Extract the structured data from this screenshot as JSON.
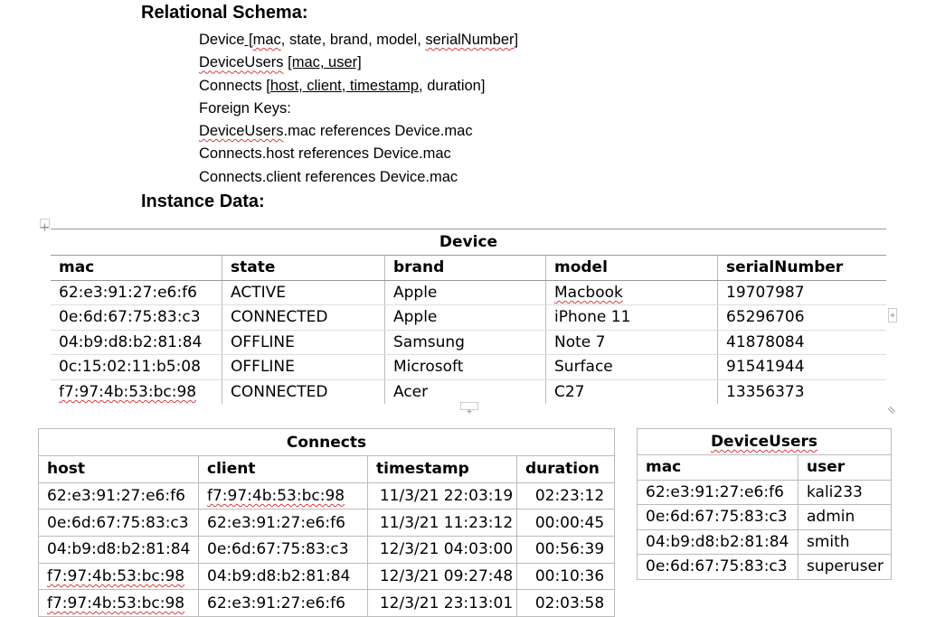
{
  "headings": {
    "schema": "Relational Schema:",
    "instance": "Instance Data:"
  },
  "schema": {
    "device": {
      "name": "Device",
      "open": " [",
      "k1": "mac",
      "rest": ", state, brand, model, ",
      "k2": "serialNumber",
      "close": "]"
    },
    "device_users": {
      "name": "DeviceUsers",
      "open": " ",
      "keys": "[mac, user]"
    },
    "connects": {
      "name": "Connects",
      "open": " [",
      "keys": "host, client, timestamp",
      "rest": ", duration]"
    },
    "fk_title": "Foreign Keys:",
    "fk1": {
      "a": "DeviceUsers",
      "b": ".mac references Device.mac"
    },
    "fk2": "Connects.host references Device.mac",
    "fk3": "Connects.client references Device.mac"
  },
  "device_table": {
    "title": "Device",
    "columns": [
      "mac",
      "state",
      "brand",
      "model",
      "serialNumber"
    ],
    "rows": [
      [
        "62:e3:91:27:e6:f6",
        "ACTIVE",
        "Apple",
        "Macbook",
        "19707987"
      ],
      [
        "0e:6d:67:75:83:c3",
        "CONNECTED",
        "Apple",
        "iPhone 11",
        "65296706"
      ],
      [
        "04:b9:d8:b2:81:84",
        "OFFLINE",
        "Samsung",
        "Note 7",
        "41878084"
      ],
      [
        "0c:15:02:11:b5:08",
        "OFFLINE",
        "Microsoft",
        "Surface",
        "91541944"
      ],
      [
        "f7:97:4b:53:bc:98",
        "CONNECTED",
        "Acer",
        "C27",
        "13356373"
      ]
    ]
  },
  "connects_table": {
    "title": "Connects",
    "columns": [
      "host",
      "client",
      "timestamp",
      "duration"
    ],
    "rows": [
      [
        "62:e3:91:27:e6:f6",
        "f7:97:4b:53:bc:98",
        "11/3/21 22:03:19",
        "02:23:12"
      ],
      [
        "0e:6d:67:75:83:c3",
        "62:e3:91:27:e6:f6",
        "11/3/21 11:23:12",
        "00:00:45"
      ],
      [
        "04:b9:d8:b2:81:84",
        "0e:6d:67:75:83:c3",
        "12/3/21 04:03:00",
        "00:56:39"
      ],
      [
        "f7:97:4b:53:bc:98",
        "04:b9:d8:b2:81:84",
        "12/3/21 09:27:48",
        "00:10:36"
      ],
      [
        "f7:97:4b:53:bc:98",
        "62:e3:91:27:e6:f6",
        "12/3/21 23:13:01",
        "02:03:58"
      ]
    ]
  },
  "device_users_table": {
    "title": "DeviceUsers",
    "columns": [
      "mac",
      "user"
    ],
    "rows": [
      [
        "62:e3:91:27:e6:f6",
        "kali233"
      ],
      [
        "0e:6d:67:75:83:c3",
        "admin"
      ],
      [
        "04:b9:d8:b2:81:84",
        "smith"
      ],
      [
        "0e:6d:67:75:83:c3",
        "superuser"
      ]
    ]
  },
  "icons": {
    "table_move": "move-handle-icon",
    "add_row": "add-row-icon",
    "add_col": "add-column-icon",
    "resize": "resize-handle-icon"
  }
}
